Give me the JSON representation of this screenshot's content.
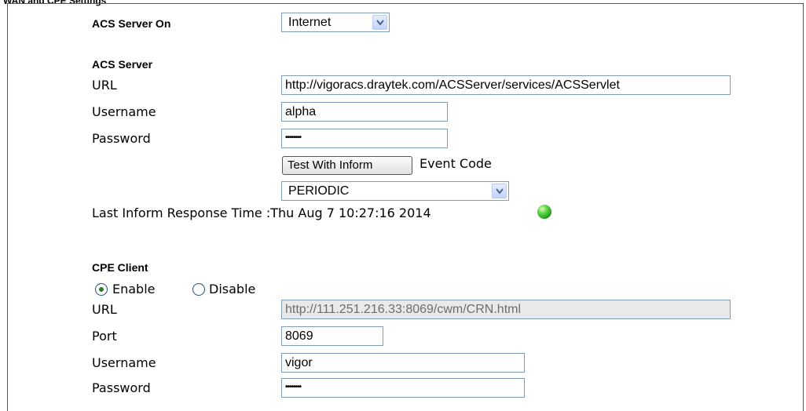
{
  "section_title": "WAN and CPE Settings",
  "acs_server_on": {
    "label": "ACS Server On",
    "selected": "Internet"
  },
  "acs_server": {
    "heading": "ACS Server",
    "url_label": "URL",
    "url_value": "http://vigoracs.draytek.com/ACSServer/services/ACSServlet",
    "username_label": "Username",
    "username_value": "alpha",
    "password_label": "Password",
    "password_mask": "••••••••",
    "test_button": "Test With Inform",
    "event_code_label": "Event Code",
    "event_code_selected": "PERIODIC",
    "last_inform_text": "Last Inform Response Time :Thu Aug 7 10:27:16 2014",
    "status_color": "#2fb52a"
  },
  "cpe_client": {
    "heading": "CPE Client",
    "enable_label": "Enable",
    "disable_label": "Disable",
    "enabled": true,
    "url_label": "URL",
    "url_value": "http://111.251.216.33:8069/cwm/CRN.html",
    "port_label": "Port",
    "port_value": "8069",
    "username_label": "Username",
    "username_value": "vigor",
    "password_label": "Password",
    "password_mask": "••••••••"
  },
  "icons": {
    "select_arrow": "chevron-down-icon",
    "status": "status-led-icon"
  }
}
